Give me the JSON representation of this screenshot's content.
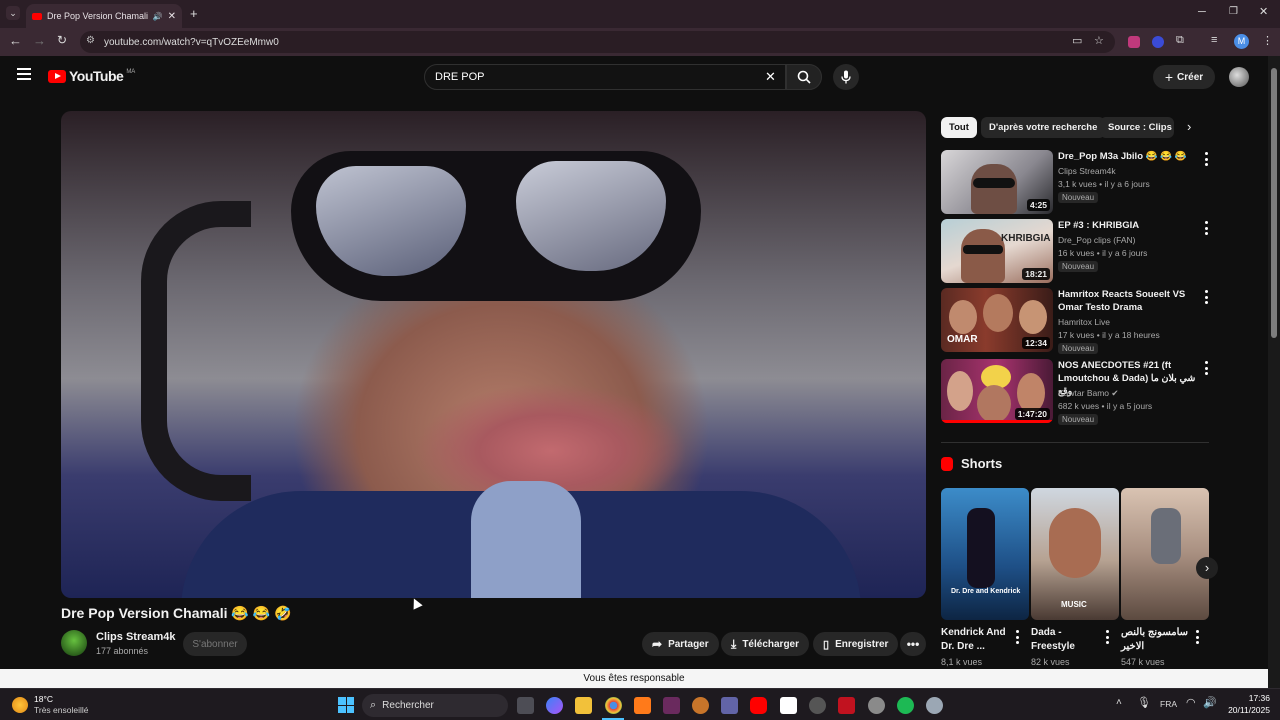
{
  "browser": {
    "tab_title": "Dre Pop Version Chamali 😂 😂 🤣",
    "url": "youtube.com/watch?v=qTvOZEeMmw0"
  },
  "header": {
    "logo": "YouTube",
    "country": "MA",
    "search_value": "DRE POP",
    "create_label": "Créer"
  },
  "video": {
    "title": "Dre Pop Version Chamali 😂 😂 🤣",
    "channel": "Clips Stream4k",
    "subscribers": "177 abonnés",
    "subscribe_label": "S'abonner",
    "share_label": "Partager",
    "download_label": "Télécharger",
    "save_label": "Enregistrer"
  },
  "filters": {
    "chips": [
      "Tout",
      "D'après votre recherche",
      "Source : Clips S"
    ]
  },
  "recommendations": [
    {
      "title": "Dre_Pop  M3a Jbilo 😂 😂 😂",
      "channel": "Clips Stream4k",
      "meta": "3,1 k vues • il y a 6 jours",
      "badge": "Nouveau",
      "duration": "4:25"
    },
    {
      "title": "EP #3 : KHRIBGIA",
      "channel": "Dre_Pop clips (FAN)",
      "meta": "16 k vues • il y a 6 jours",
      "badge": "Nouveau",
      "duration": "18:21"
    },
    {
      "title": "Hamritox Reacts Soueelt VS Omar Testo Drama",
      "channel": "Hamritox Live",
      "meta": "17 k vues • il y a 18 heures",
      "badge": "Nouveau",
      "duration": "12:34"
    },
    {
      "title": "NOS ANECDOTES #21 (ft Lmoutchou & Dada) شي بلان ما وقع",
      "channel": "Kawtar Bamo ✔",
      "meta": "682 k vues • il y a 5 jours",
      "badge": "Nouveau",
      "duration": "1:47:20"
    }
  ],
  "shorts": {
    "heading": "Shorts",
    "items": [
      {
        "title": "Kendrick And Dr. Dre ...",
        "views": "8,1 k vues"
      },
      {
        "title": "Dada - Freestyle",
        "views": "82 k vues"
      },
      {
        "title": "سامسونج بالنص الاخير",
        "views": "547 k vues"
      }
    ]
  },
  "tooltip": "Vous êtes responsable",
  "taskbar": {
    "weather_temp": "18°C",
    "weather_desc": "Très ensoleillé",
    "search_label": "Rechercher",
    "language": "FRA",
    "time": "17:36",
    "date": "20/11/2025"
  },
  "colors": {
    "accent": "#ff0000",
    "background": "#0f0f0f",
    "chip_active": "#f1f1f1"
  }
}
